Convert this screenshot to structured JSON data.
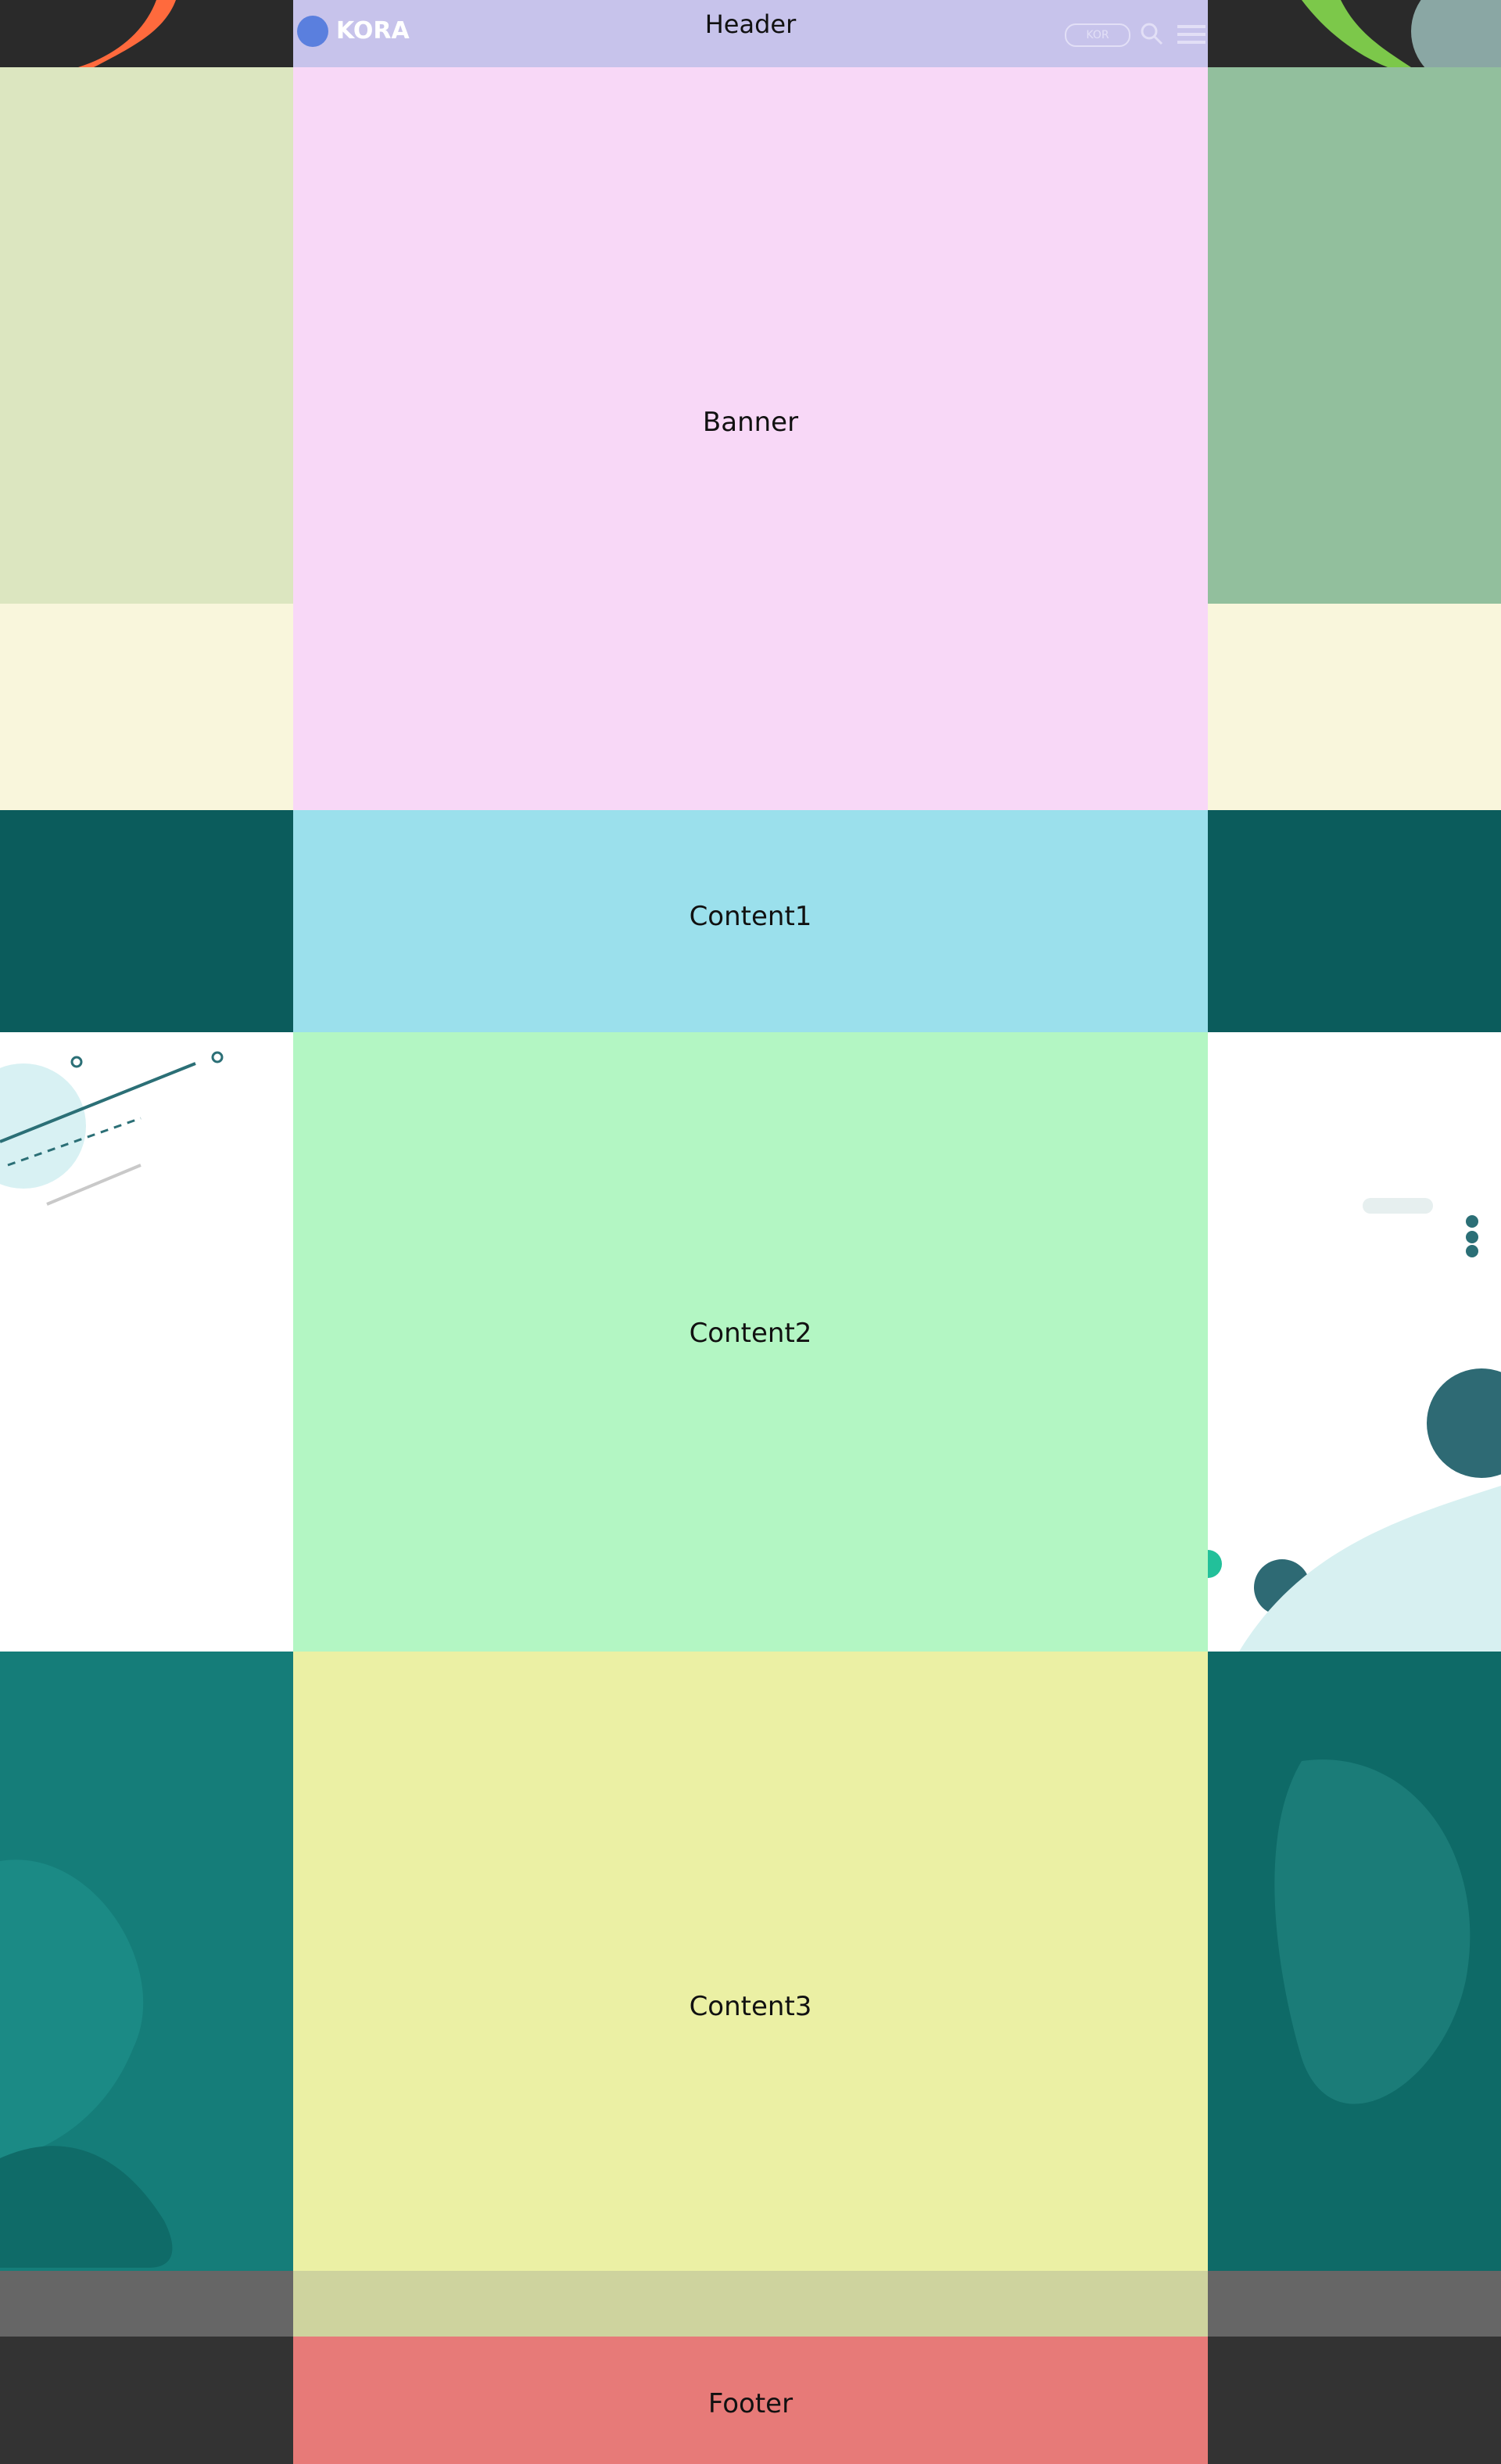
{
  "header": {
    "section_label": "Header",
    "logo_text": "KORA",
    "lang": "KOR"
  },
  "banner": {
    "section_label": "Banner"
  },
  "content1": {
    "section_label": "Content1"
  },
  "content2": {
    "section_label": "Content2"
  },
  "content3": {
    "section_label": "Content3"
  },
  "footer": {
    "section_label": "Footer"
  },
  "colors": {
    "header_overlay": "#c7c3eb",
    "banner_overlay": "#f8d8f7",
    "content1_overlay": "#9be0ec",
    "content2_overlay": "#b3f6c3",
    "content3_overlay": "#ebf0a4",
    "footer_overlay": "#e77a78"
  }
}
